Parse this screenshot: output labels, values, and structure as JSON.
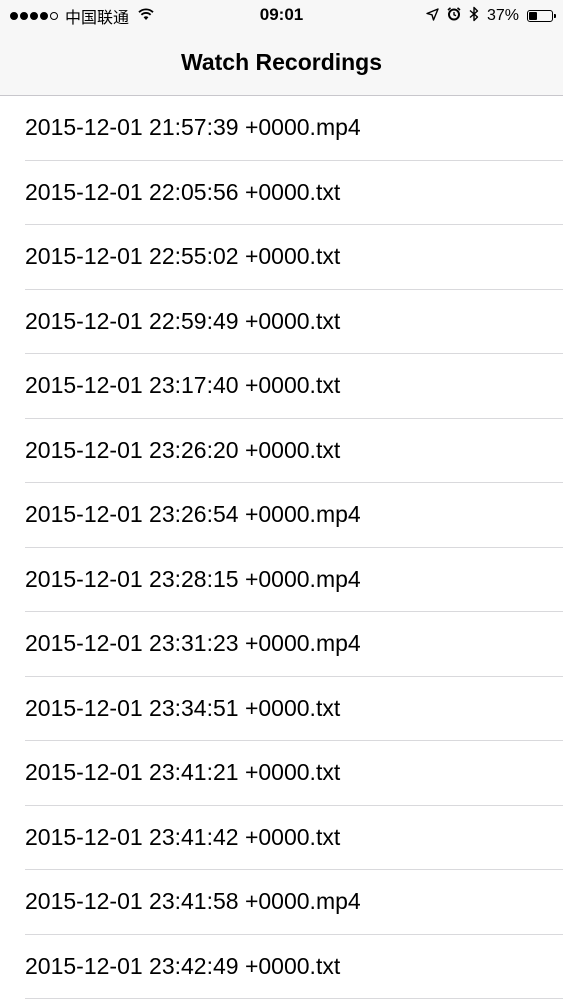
{
  "status_bar": {
    "carrier": "中国联通",
    "time": "09:01",
    "battery_percent": "37%",
    "battery_level": 0.37,
    "signal_bars_filled": 4,
    "signal_bars_total": 5,
    "icons": [
      "wifi-icon",
      "location-arrow-icon",
      "alarm-clock-icon",
      "bluetooth-icon",
      "battery-icon"
    ]
  },
  "nav": {
    "title": "Watch Recordings"
  },
  "recordings": [
    "2015-12-01 21:57:39 +0000.mp4",
    "2015-12-01 22:05:56 +0000.txt",
    "2015-12-01 22:55:02 +0000.txt",
    "2015-12-01 22:59:49 +0000.txt",
    "2015-12-01 23:17:40 +0000.txt",
    "2015-12-01 23:26:20 +0000.txt",
    "2015-12-01 23:26:54 +0000.mp4",
    "2015-12-01 23:28:15 +0000.mp4",
    "2015-12-01 23:31:23 +0000.mp4",
    "2015-12-01 23:34:51 +0000.txt",
    "2015-12-01 23:41:21 +0000.txt",
    "2015-12-01 23:41:42 +0000.txt",
    "2015-12-01 23:41:58 +0000.mp4",
    "2015-12-01 23:42:49 +0000.txt"
  ]
}
